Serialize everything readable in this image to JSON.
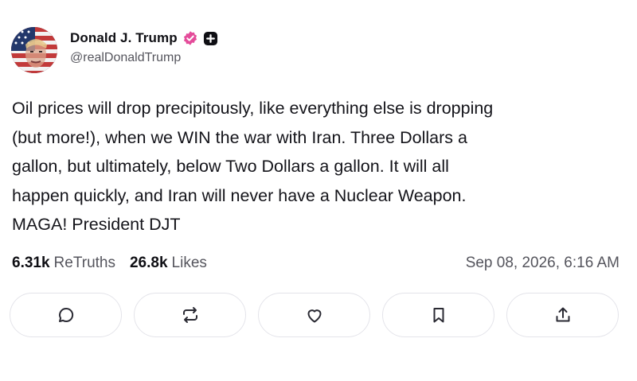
{
  "author": {
    "name": "Donald J. Trump",
    "handle": "@realDonaldTrump",
    "verified_color": "#e44c9a"
  },
  "post": {
    "text": "Oil prices will drop precipitously, like everything else is dropping\n(but more!), when we WIN the war with Iran. Three Dollars a\ngallon, but ultimately, below Two Dollars a gallon. It will all\nhappen quickly, and Iran will never have a Nuclear Weapon.\nMAGA! President DJT"
  },
  "stats": {
    "retruths_count": "6.31k",
    "retruths_label": "ReTruths",
    "likes_count": "26.8k",
    "likes_label": "Likes",
    "timestamp": "Sep 08, 2026, 6:16 AM"
  },
  "actions": [
    "reply-icon",
    "retruth-icon",
    "like-icon",
    "bookmark-icon",
    "share-icon"
  ]
}
